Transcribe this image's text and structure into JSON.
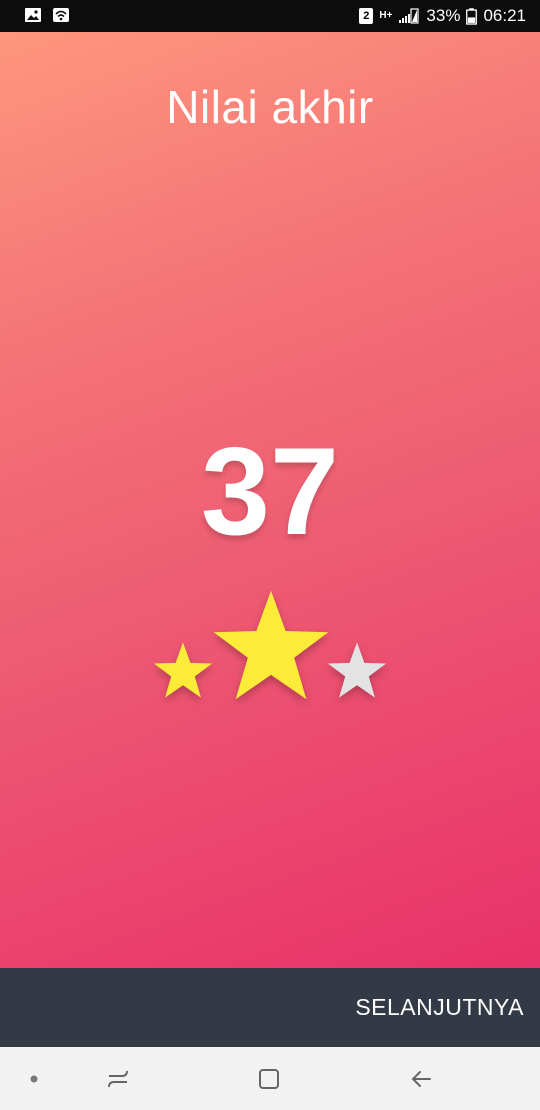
{
  "status_bar": {
    "sim_badge": "2",
    "network_type": "H+",
    "battery_percent": "33%",
    "time": "06:21",
    "icons": [
      "image-icon",
      "wifi-icon",
      "signal-icon",
      "battery-icon"
    ]
  },
  "screen": {
    "title": "Nilai akhir",
    "score": "37",
    "stars": {
      "earned": 2,
      "total": 3
    },
    "colors": {
      "gradient_top": "#ff967c",
      "gradient_bottom": "#e8316a",
      "star_filled": "#fdeb3a",
      "star_empty": "#e3e3e3"
    }
  },
  "bottom_bar": {
    "next_label": "SELANJUTNYA",
    "background": "#333a45"
  },
  "nav_bar": {
    "items": [
      "dot-icon",
      "recent-apps-icon",
      "home-icon",
      "back-icon"
    ]
  }
}
